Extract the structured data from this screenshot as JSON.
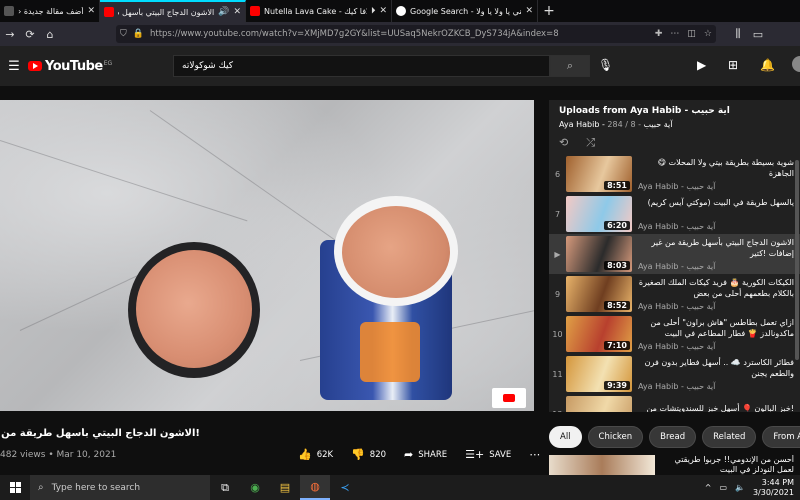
{
  "browser": {
    "tabs": [
      {
        "title": "أضف مقالة جديدة ‹ تقني",
        "icon": "wordpress-icon",
        "color": "#3a3a3a"
      },
      {
        "title": "الاشون الدجاج البيتي بأسهل ط",
        "icon": "youtube-icon",
        "color": "#ff0000",
        "active": true
      },
      {
        "title": "Nutella Lava Cake - لافا كيك",
        "icon": "youtube-icon",
        "color": "#ff0000"
      },
      {
        "title": "Google Search - معني يا ولا يا ولا",
        "icon": "google-icon",
        "color": "#ffffff"
      }
    ],
    "url": "https://www.youtube.com/watch?v=XMjMD7g2GY&list=UUSaq5NekrOZKCB_DyS734jA&index=8"
  },
  "youtube": {
    "logo_text": "YouTube",
    "country_code": "EG",
    "search_value": "كيك شوكولاته"
  },
  "video": {
    "title": "!الاشون الدجاج البيتي بأسهل طريقة من غير إضافات",
    "views": "482 views • Mar 10, 2021",
    "likes": "62K",
    "dislikes": "820",
    "share_label": "SHARE",
    "save_label": "SAVE"
  },
  "playlist": {
    "title": "Uploads from Aya Habib - آية حبيب",
    "subtitle_channel": "Aya Habib - آية حبيب",
    "position": "8 / 284",
    "items": [
      {
        "index": "6",
        "title": "شوية بسيطة بطريقة بيتي ولا المحلات 😋 الجاهزة",
        "duration": "8:51",
        "channel": "Aya Habib - آية حبيب",
        "colors": [
          "#a0612e",
          "#e7c89e"
        ]
      },
      {
        "index": "7",
        "title": "يالسهل طريقة في البيت (موكتي آيس كريم)",
        "duration": "6:20",
        "channel": "Aya Habib - آية حبيب",
        "colors": [
          "#f3c9c4",
          "#8ec9e8"
        ]
      },
      {
        "index": "",
        "title": "الاشون الدجاج البيتي بأسهل طريقة من غير إضافات !كتير",
        "duration": "8:03",
        "channel": "Aya Habib - آية حبيب",
        "colors": [
          "#d69a7c",
          "#2b2b2b"
        ],
        "current": true
      },
      {
        "index": "9",
        "title": "الكيكات الكورية 🎂 فريد كيكات الملك الصغيرة بالكلام بطعمهم أحلى من بعض",
        "duration": "8:52",
        "channel": "Aya Habib - آية حبيب",
        "colors": [
          "#e8b36a",
          "#6f3e20"
        ]
      },
      {
        "index": "10",
        "title": "ازاي تعمل بطاطس \"هاش براون\" أحلى من ماكدونالدز 🍟 فطار المطاعم في البيت",
        "duration": "7:10",
        "channel": "Aya Habib - آية حبيب",
        "colors": [
          "#e0a046",
          "#b8402e"
        ]
      },
      {
        "index": "11",
        "title": "فطائر الكاسترد ☁️ .. أسهل فطاير بدون فرن والطعم يجنن",
        "duration": "9:39",
        "channel": "Aya Habib - آية حبيب",
        "colors": [
          "#d4963c",
          "#f3e1b2"
        ]
      },
      {
        "index": "12",
        "title": "!خبز البالون 🎈 أسهل خبز للسندويتشات من غير فرن",
        "duration": "",
        "channel": "",
        "colors": [
          "#c79a63",
          "#f0d9a8"
        ]
      }
    ]
  },
  "chips": [
    {
      "label": "All",
      "active": true
    },
    {
      "label": "Chicken"
    },
    {
      "label": "Bread"
    },
    {
      "label": "Related"
    },
    {
      "label": "From Aya H"
    }
  ],
  "recommendation": {
    "title": "أحسن من الإندومي!! جربوا طريقتي لعمل النودلز في البيت"
  },
  "taskbar": {
    "search_placeholder": "Type here to search",
    "time": "3:44 PM",
    "date": "3/30/2021"
  }
}
